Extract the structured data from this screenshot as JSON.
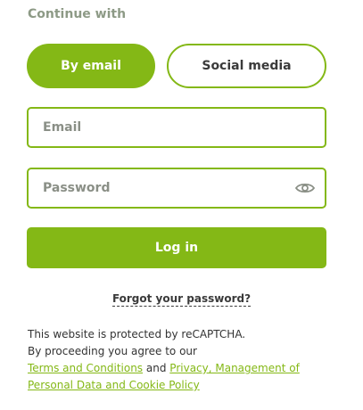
{
  "heading": "Continue with",
  "tabs": {
    "active_label": "By email",
    "inactive_label": "Social media"
  },
  "form": {
    "email_placeholder": "Email",
    "password_placeholder": "Password",
    "password_toggle_icon": "eye-icon",
    "login_label": "Log in"
  },
  "forgot_password": "Forgot your password?",
  "legal": {
    "line1": "This website is protected by reCAPTCHA.",
    "line2": "By proceeding you agree to our",
    "terms_link": "Terms and Conditions",
    "conjunction": "and",
    "privacy_link": "Privacy, Management of Personal Data and Cookie Policy"
  },
  "colors": {
    "accent": "#84b816",
    "heading": "#8d9a86",
    "text": "#333333"
  }
}
